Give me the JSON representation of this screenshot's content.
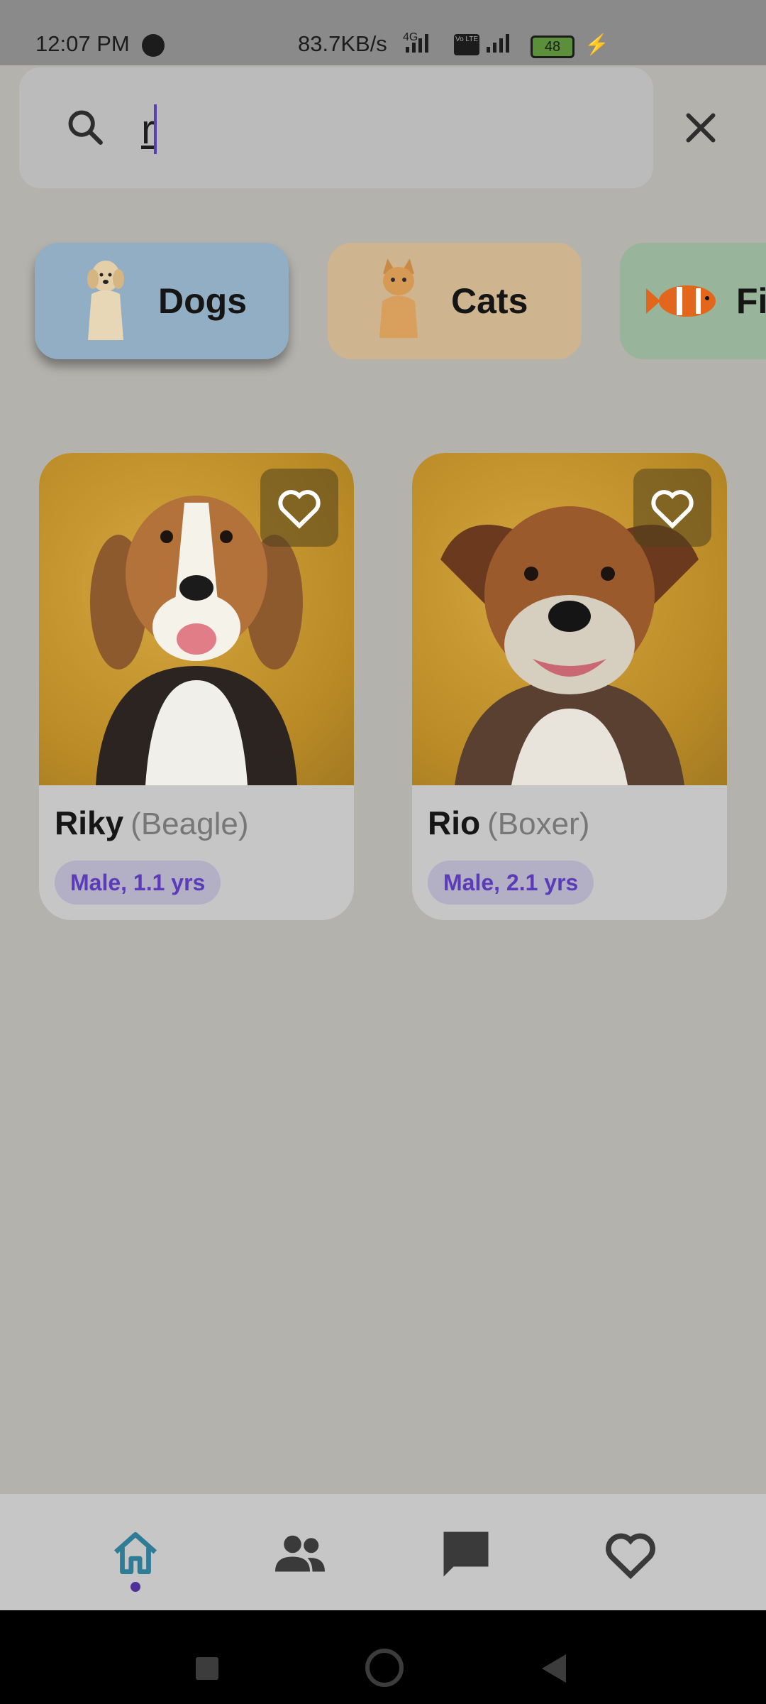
{
  "status_bar": {
    "time": "12:07 PM",
    "speed": "83.7KB/s",
    "network_label": "4G",
    "volte_label": "Vo LTE",
    "battery": "48"
  },
  "search": {
    "value": "r",
    "placeholder": ""
  },
  "categories": [
    {
      "label": "Dogs",
      "color": "#91aec4"
    },
    {
      "label": "Cats",
      "color": "#cfb58f"
    },
    {
      "label": "Fi",
      "color": "#98b49b"
    }
  ],
  "pets": [
    {
      "name": "Riky",
      "breed": "(Beagle)",
      "tag": "Male, 1.1 yrs"
    },
    {
      "name": "Rio",
      "breed": "(Boxer)",
      "tag": "Male, 2.1 yrs"
    }
  ],
  "bottom_nav": {
    "items": [
      "home-icon",
      "people-icon",
      "chat-icon",
      "heart-icon"
    ],
    "active": "home",
    "accent": "#2f7c96"
  }
}
